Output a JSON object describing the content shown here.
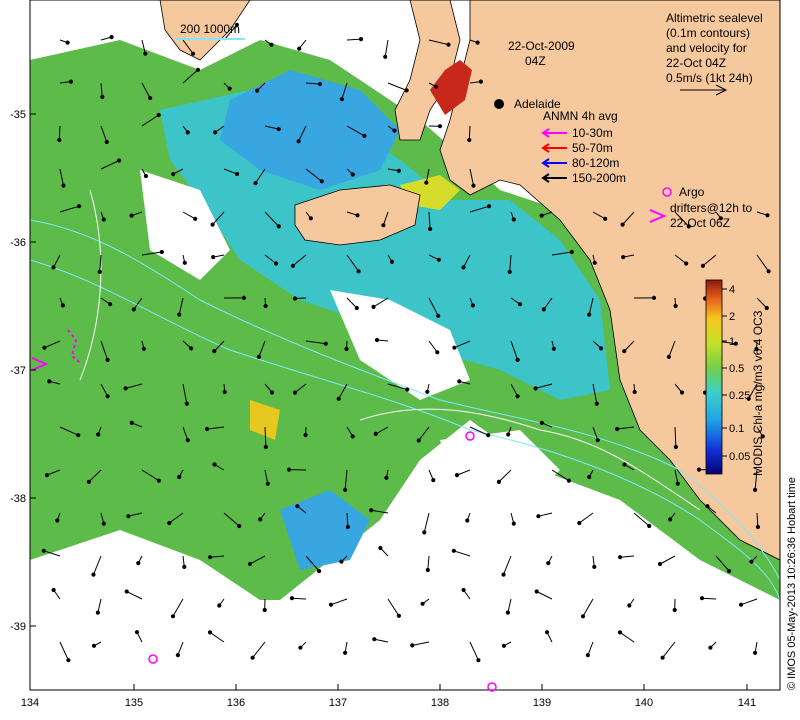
{
  "title": {
    "date": "22-Oct-2009",
    "time": "04Z"
  },
  "place_label": "Adelaide",
  "scale_label": "200  1000m",
  "sealevel_legend": [
    "Altimetric sealevel",
    "(0.1m contours)",
    "and velocity for",
    "22-Oct 04Z",
    "0.5m/s (1kt 24h)"
  ],
  "anmn_legend": {
    "title": "ANMN 4h avg",
    "entries": [
      {
        "label": "10-30m",
        "color": "#ff00ff"
      },
      {
        "label": "50-70m",
        "color": "#ff0000"
      },
      {
        "label": "80-120m",
        "color": "#0000ff"
      },
      {
        "label": "150-200m",
        "color": "#000000"
      }
    ]
  },
  "argo_legend": [
    "Argo",
    "drifters@12h to",
    "22-Oct 06Z"
  ],
  "colorbar": {
    "label": "MODIS Chl-a mg/m3 v6.4 OC3",
    "ticks": [
      "4",
      "2",
      "1",
      "0.5",
      "0.25",
      "0.1",
      "0.05"
    ]
  },
  "x_ticks": [
    "134",
    "135",
    "136",
    "137",
    "138",
    "139",
    "140",
    "141"
  ],
  "y_ticks": [
    "-35",
    "-36",
    "-37",
    "-38",
    "-39"
  ],
  "credit": "© IMOS 05-May-2013 10:26:36 Hobart time",
  "colors": {
    "land": "#f6c89d",
    "ocean_green": "#59b94a",
    "ocean_cyan": "#3cc4c8",
    "ocean_blue": "#38a6e0",
    "argo": "#ff00ff"
  }
}
